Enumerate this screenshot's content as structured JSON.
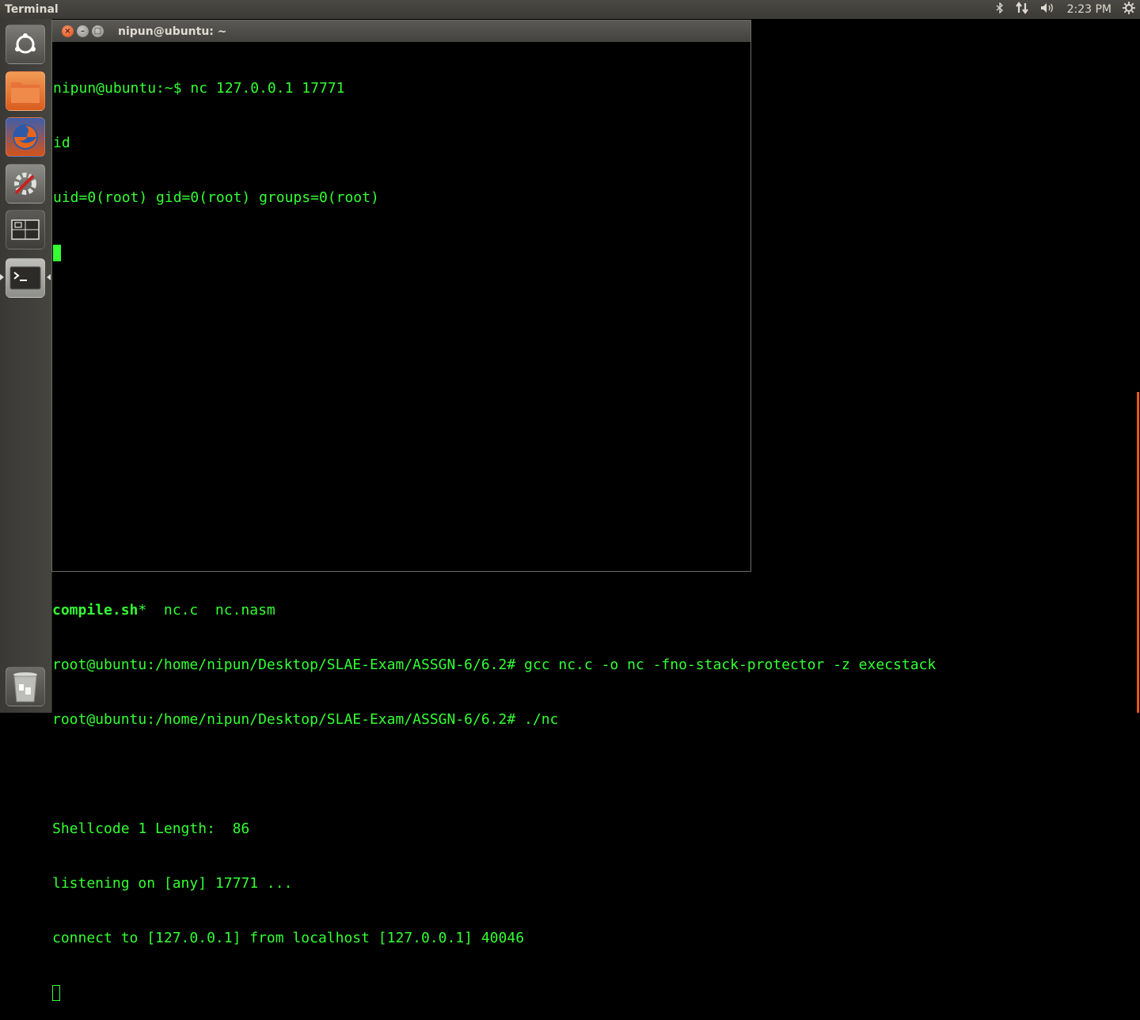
{
  "panel": {
    "app_title": "Terminal",
    "clock": "2:23 PM"
  },
  "indicators": {
    "bluetooth_icon": "bluetooth-icon",
    "network_icon": "network-icon",
    "volume_icon": "volume-icon",
    "session_icon": "gear-icon"
  },
  "launcher": [
    {
      "name": "dash-icon"
    },
    {
      "name": "files-icon"
    },
    {
      "name": "firefox-icon"
    },
    {
      "name": "settings-icon"
    },
    {
      "name": "workspace-icon"
    },
    {
      "name": "terminal-icon"
    },
    {
      "name": "trash-icon"
    }
  ],
  "front_window": {
    "title": "nipun@ubuntu: ~",
    "lines": [
      "nipun@ubuntu:~$ nc 127.0.0.1 17771",
      "id",
      "uid=0(root) gid=0(root) groups=0(root)"
    ]
  },
  "bg_terminal": {
    "partial_line": {
      "file1": "compile.sh",
      "suffix1": "*  ",
      "file2": "nc.c  nc.nasm"
    },
    "lines": [
      "root@ubuntu:/home/nipun/Desktop/SLAE-Exam/ASSGN-6/6.2# gcc nc.c -o nc -fno-stack-protector -z execstack",
      "root@ubuntu:/home/nipun/Desktop/SLAE-Exam/ASSGN-6/6.2# ./nc",
      "",
      "Shellcode 1 Length:  86",
      "listening on [any] 17771 ...",
      "connect to [127.0.0.1] from localhost [127.0.0.1] 40046"
    ]
  },
  "colors": {
    "terminal_text": "#33ff33",
    "panel_bg": "#3b3a36",
    "accent_orange": "#e35b1c"
  }
}
